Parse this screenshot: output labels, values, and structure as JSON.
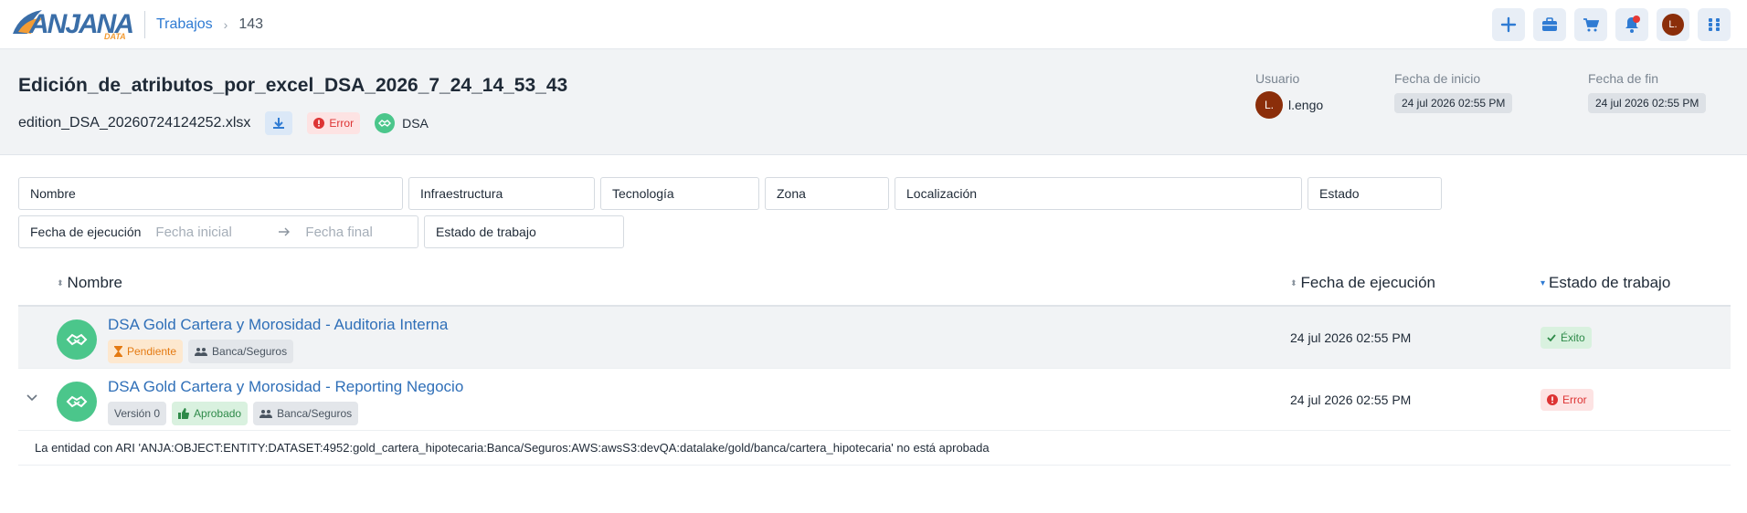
{
  "app": {
    "logo_text": "ANJANA",
    "logo_sub": "DATA"
  },
  "breadcrumb": {
    "parent": "Trabajos",
    "current": "143"
  },
  "topbar": {
    "user_initial": "L."
  },
  "job": {
    "title": "Edición_de_atributos_por_excel_DSA_2026_7_24_14_53_43",
    "file_name": "edition_DSA_20260724124252.xlsx",
    "status": "Error",
    "dsa_label": "DSA"
  },
  "meta": {
    "user_label": "Usuario",
    "user_initial": "L.",
    "user_name": "l.engo",
    "start_label": "Fecha de inicio",
    "start_value": "24 jul 2026 02:55 PM",
    "end_label": "Fecha de fin",
    "end_value": "24 jul 2026 02:55 PM"
  },
  "filters": {
    "nombre": "Nombre",
    "infraestructura": "Infraestructura",
    "tecnologia": "Tecnología",
    "zona": "Zona",
    "localizacion": "Localización",
    "estado": "Estado",
    "fecha_ejecucion": "Fecha de ejecución",
    "fecha_inicial_ph": "Fecha inicial",
    "fecha_final_ph": "Fecha final",
    "estado_trabajo": "Estado de trabajo"
  },
  "table": {
    "col_nombre": "Nombre",
    "col_fecha": "Fecha de ejecución",
    "col_estado": "Estado de trabajo",
    "rows": [
      {
        "name": "DSA Gold Cartera y Morosidad - Auditoria Interna",
        "tag_status": "Pendiente",
        "tag_group": "Banca/Seguros",
        "date": "24 jul 2026 02:55 PM",
        "job_status": "Éxito"
      },
      {
        "name": "DSA Gold Cartera y Morosidad - Reporting Negocio",
        "tag_version": "Versión 0",
        "tag_status": "Aprobado",
        "tag_group": "Banca/Seguros",
        "date": "24 jul 2026 02:55 PM",
        "job_status": "Error"
      }
    ],
    "message": "La entidad con ARI 'ANJA:OBJECT:ENTITY:DATASET:4952:gold_cartera_hipotecaria:Banca/Seguros:AWS:awsS3:devQA:datalake/gold/banca/cartera_hipotecaria' no está aprobada"
  },
  "colors": {
    "accent": "#2f7bd3",
    "success": "#4bc68b",
    "error": "#dd3333",
    "warning": "#e47a12"
  }
}
